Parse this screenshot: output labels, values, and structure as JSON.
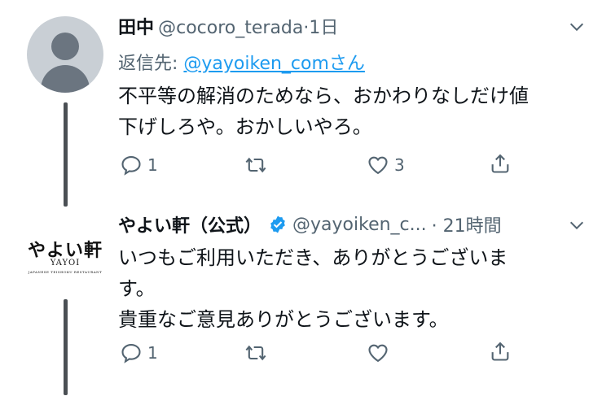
{
  "tweet1": {
    "name": "田中",
    "handle": "@cocoro_terada",
    "time": "·1日",
    "reply_prefix": "返信先: ",
    "reply_to": "@yayoiken_comさん",
    "text_line1": "不平等の解消のためなら、おかわりなしだけ値",
    "text_line2": "下げしろや。おかしいやろ。",
    "reply_count": "1",
    "retweet_count": "",
    "like_count": "3"
  },
  "tweet2": {
    "name": "やよい軒（公式）",
    "handle": "@yayoiken_c...",
    "time": "· 21時間",
    "text_line1": "いつもご利用いただき、ありがとうございま",
    "text_line2": "す。",
    "text_line3": "貴重なご意見ありがとうございます。",
    "reply_count": "1",
    "retweet_count": "",
    "like_count": "",
    "logo_main": "やよい軒",
    "logo_sub": "YAYOI",
    "logo_tag": "JAPANESE TEISHOKU RESTAURANT"
  },
  "colors": {
    "text": "#0f1419",
    "muted": "#536471",
    "link": "#1d9bf0",
    "verified": "#1d9bf0"
  }
}
